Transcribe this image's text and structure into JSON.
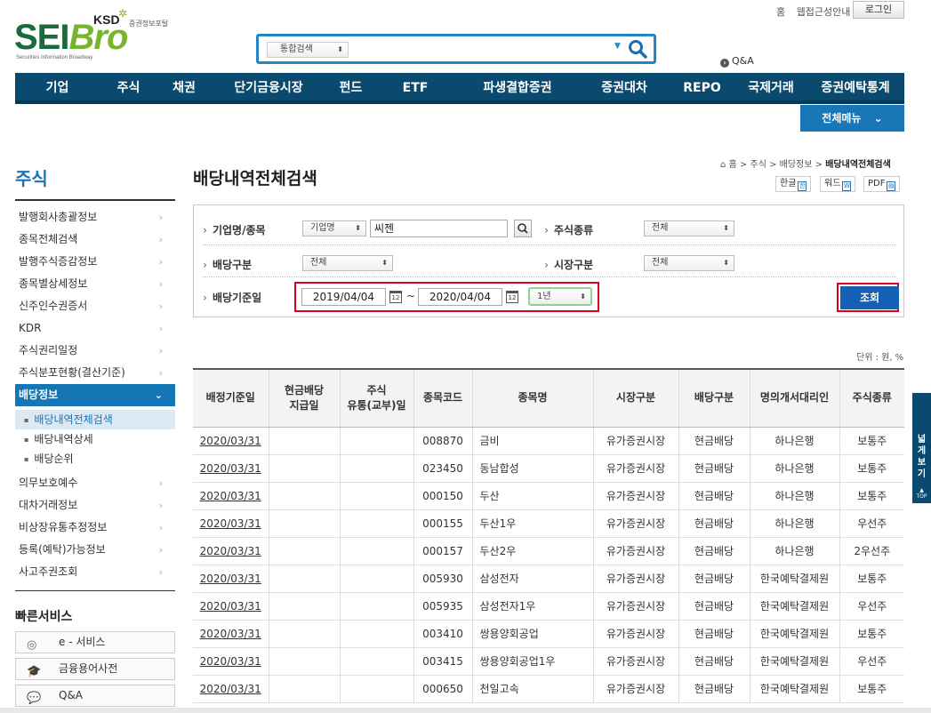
{
  "logo": {
    "main_a": "SEI",
    "main_b": "Bro",
    "ksd": "KSD",
    "portal": "증권정보포털",
    "sub": "Securities Information Broadway"
  },
  "top_links": [
    "홈",
    "웹접근성안내"
  ],
  "login_label": "로그인",
  "search": {
    "scope": "통합검색",
    "value": ""
  },
  "qa_label": "Q&A",
  "gnb": [
    "기업",
    "주식",
    "채권",
    "단기금융시장",
    "펀드",
    "ETF",
    "파생결합증권",
    "증권대차",
    "REPO",
    "국제거래",
    "증권예탁통계"
  ],
  "all_menu": "전체메뉴",
  "sidebar": {
    "title": "주식",
    "items_top": [
      "발행회사총괄정보",
      "종목전체검색",
      "발행주식증감정보",
      "종목별상세정보",
      "신주인수권증서",
      "KDR",
      "주식권리일정",
      "주식분포현황(결산기준)"
    ],
    "active": "배당정보",
    "sub": [
      "배당내역전체검색",
      "배당내역상세",
      "배당순위"
    ],
    "items_bottom": [
      "의무보호예수",
      "대차거래정보",
      "비상장유통추정정보",
      "등록(예탁)가능정보",
      "사고주권조회"
    ],
    "quick_title": "빠른서비스",
    "quick": [
      "e - 서비스",
      "금융용어사전",
      "Q&A"
    ]
  },
  "page_title": "배당내역전체검색",
  "breadcrumb": [
    "홈",
    "주식",
    "배당정보",
    "배당내역전체검색"
  ],
  "doc_buttons": [
    "한글",
    "워드",
    "PDF"
  ],
  "form": {
    "company_label": "기업명/종목",
    "company_type": "기업명",
    "company_value": "씨젠",
    "stock_type_label": "주식종류",
    "stock_type_value": "전체",
    "div_type_label": "배당구분",
    "div_type_value": "전체",
    "market_label": "시장구분",
    "market_value": "전체",
    "base_date_label": "배당기준일",
    "date_from": "2019/04/04",
    "date_sep": "~",
    "date_to": "2020/04/04",
    "period": "1년",
    "query_label": "조회"
  },
  "unit": "단위 : 원, %",
  "table": {
    "headers": [
      "배정기준일",
      "현금배당\n지급일",
      "주식\n유통(교부)일",
      "종목코드",
      "종목명",
      "시장구분",
      "배당구분",
      "명의개서대리인",
      "주식종류"
    ],
    "rows": [
      [
        "2020/03/31",
        "",
        "",
        "008870",
        "금비",
        "유가증권시장",
        "현금배당",
        "하나은행",
        "보통주"
      ],
      [
        "2020/03/31",
        "",
        "",
        "023450",
        "동남합성",
        "유가증권시장",
        "현금배당",
        "하나은행",
        "보통주"
      ],
      [
        "2020/03/31",
        "",
        "",
        "000150",
        "두산",
        "유가증권시장",
        "현금배당",
        "하나은행",
        "보통주"
      ],
      [
        "2020/03/31",
        "",
        "",
        "000155",
        "두산1우",
        "유가증권시장",
        "현금배당",
        "하나은행",
        "우선주"
      ],
      [
        "2020/03/31",
        "",
        "",
        "000157",
        "두산2우",
        "유가증권시장",
        "현금배당",
        "하나은행",
        "2우선주"
      ],
      [
        "2020/03/31",
        "",
        "",
        "005930",
        "삼성전자",
        "유가증권시장",
        "현금배당",
        "한국예탁결제원",
        "보통주"
      ],
      [
        "2020/03/31",
        "",
        "",
        "005935",
        "삼성전자1우",
        "유가증권시장",
        "현금배당",
        "한국예탁결제원",
        "우선주"
      ],
      [
        "2020/03/31",
        "",
        "",
        "003410",
        "쌍용양회공업",
        "유가증권시장",
        "현금배당",
        "한국예탁결제원",
        "보통주"
      ],
      [
        "2020/03/31",
        "",
        "",
        "003415",
        "쌍용양회공업1우",
        "유가증권시장",
        "현금배당",
        "한국예탁결제원",
        "우선주"
      ],
      [
        "2020/03/31",
        "",
        "",
        "000650",
        "천일고속",
        "유가증권시장",
        "현금배당",
        "한국예탁결제원",
        "보통주"
      ]
    ]
  },
  "side_tab": {
    "label": "넓게보기",
    "top": "TOP"
  },
  "colors": {
    "nav": "#0b4a6f",
    "accent": "#1576b6",
    "highlight": "#d9001b",
    "search_border": "#2384c6"
  }
}
